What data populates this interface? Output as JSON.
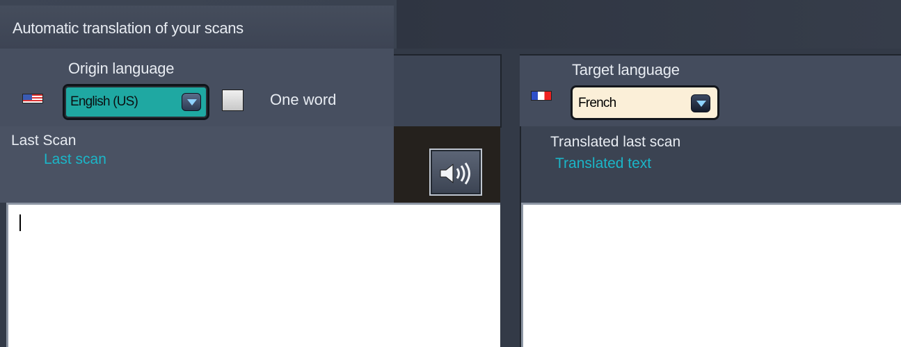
{
  "window": {
    "title": "Automatic translation of your scans"
  },
  "origin": {
    "label": "Origin language",
    "flag": "us-flag-icon",
    "language": "English (US)",
    "one_word_label": "One word",
    "one_word_checked": false
  },
  "target": {
    "label": "Target language",
    "flag": "fr-flag-icon",
    "language": "French"
  },
  "last_scan": {
    "title": "Last Scan",
    "subtitle": "Last scan",
    "text": ""
  },
  "translated": {
    "title": "Translated last scan",
    "subtitle": "Translated text",
    "text": ""
  },
  "speaker_button": {
    "icon": "speaker-icon"
  },
  "colors": {
    "accent_teal": "#1fa8a2",
    "subtitle_cyan": "#1bb6c8",
    "panel_bg": "#474f60",
    "target_dropdown_bg": "#fbefd8"
  }
}
